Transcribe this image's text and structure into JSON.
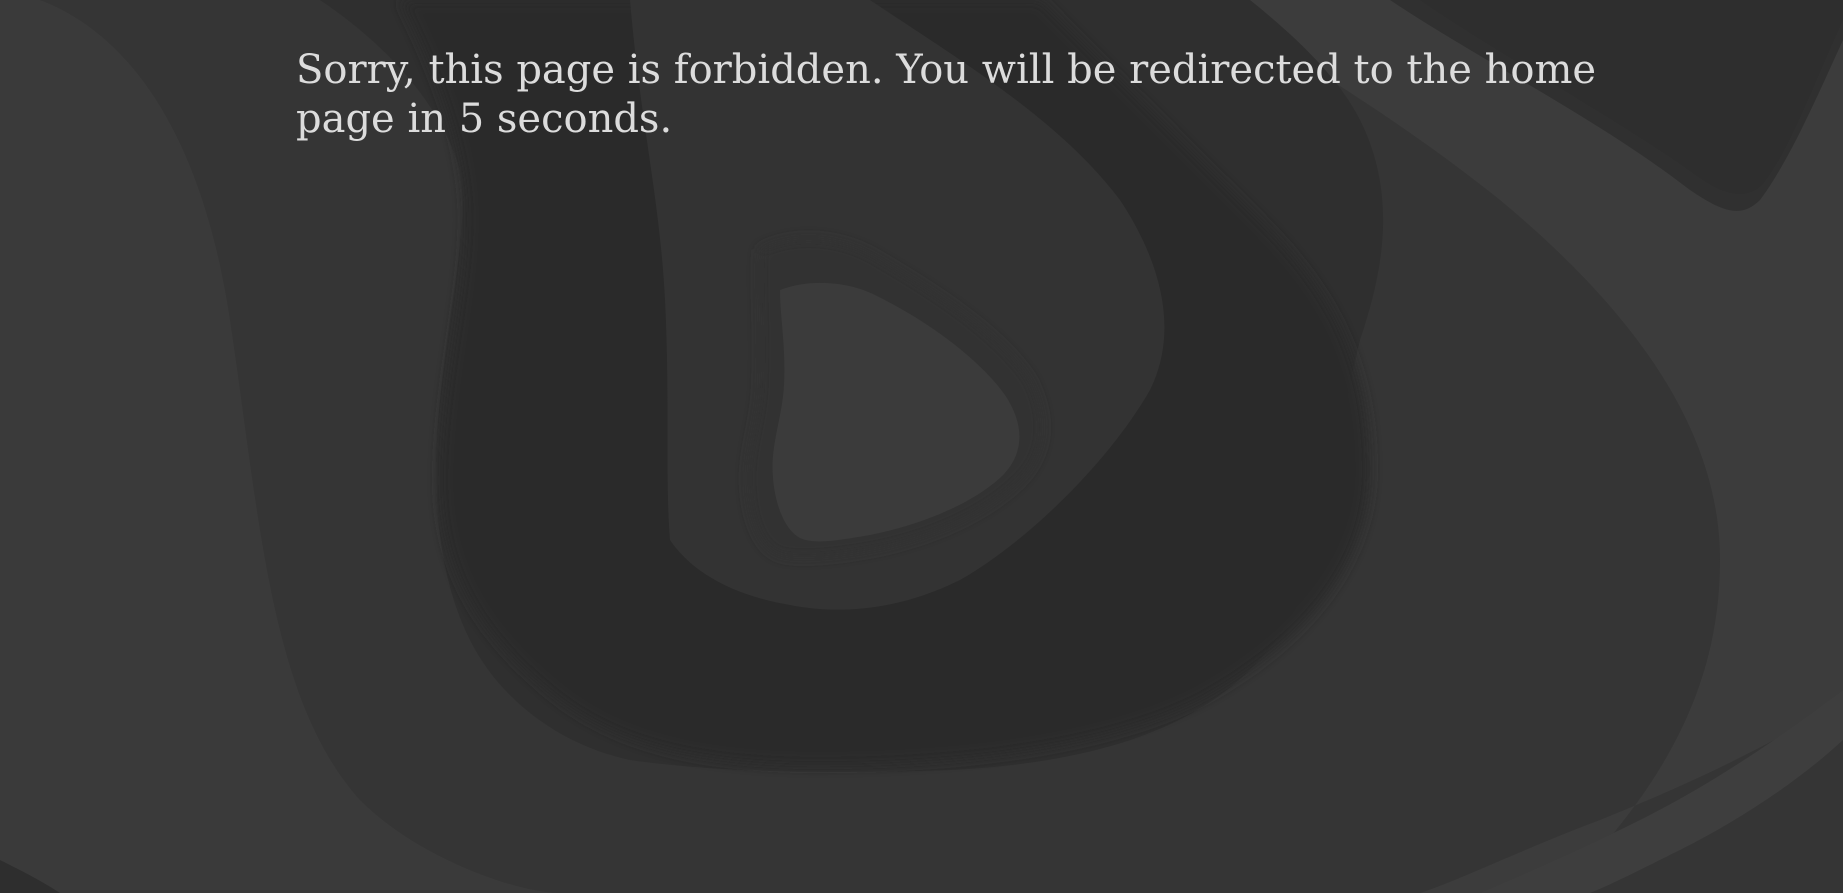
{
  "page": {
    "message": "Sorry, this page is forbidden. You will be redirected to the home page in 5 seconds."
  },
  "colors": {
    "background": "#363636",
    "dark_band": "#2b2b2b",
    "mid_band": "#3a3a3a",
    "light_band": "#404040",
    "text": "#dcdcdc"
  }
}
